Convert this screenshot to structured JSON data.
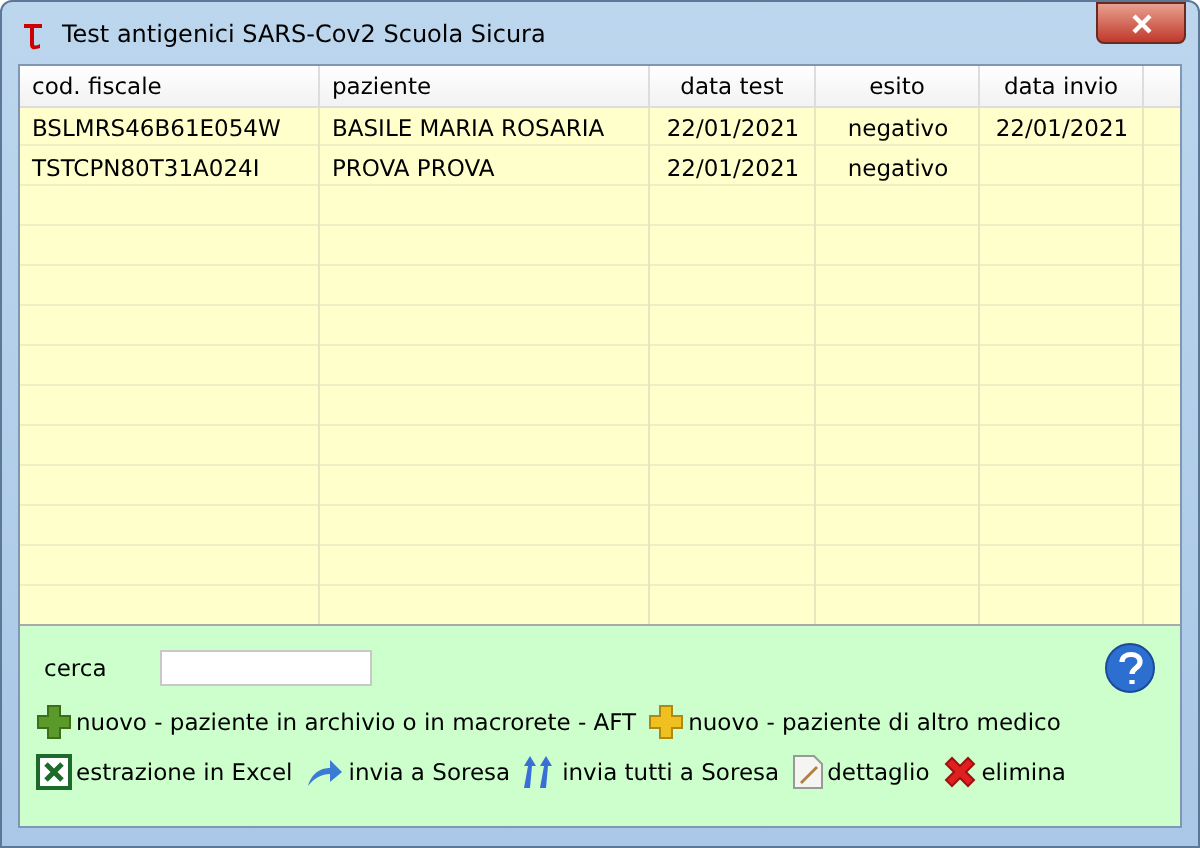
{
  "window": {
    "title": "Test antigenici SARS-Cov2 Scuola Sicura"
  },
  "table": {
    "columns": [
      "cod. fiscale",
      "paziente",
      "data test",
      "esito",
      "data invio"
    ],
    "rows": [
      [
        "BSLMRS46B61E054W",
        "BASILE MARIA ROSARIA",
        "22/01/2021",
        "negativo",
        "22/01/2021"
      ],
      [
        "TSTCPN80T31A024I",
        "PROVA PROVA",
        "22/01/2021",
        "negativo",
        ""
      ]
    ]
  },
  "search": {
    "label": "cerca"
  },
  "actions_row1": [
    {
      "kind": "plus-green",
      "label": "nuovo - paziente in archivio o in macrorete - AFT"
    },
    {
      "kind": "plus-yellow",
      "label": "nuovo - paziente di altro medico"
    }
  ],
  "actions_row2": [
    {
      "kind": "excel",
      "label": "estrazione in Excel"
    },
    {
      "kind": "send",
      "label": "invia a Soresa"
    },
    {
      "kind": "send-all",
      "label": "invia tutti a Soresa"
    },
    {
      "kind": "detail",
      "label": "dettaglio"
    },
    {
      "kind": "delete",
      "label": "elimina"
    }
  ]
}
